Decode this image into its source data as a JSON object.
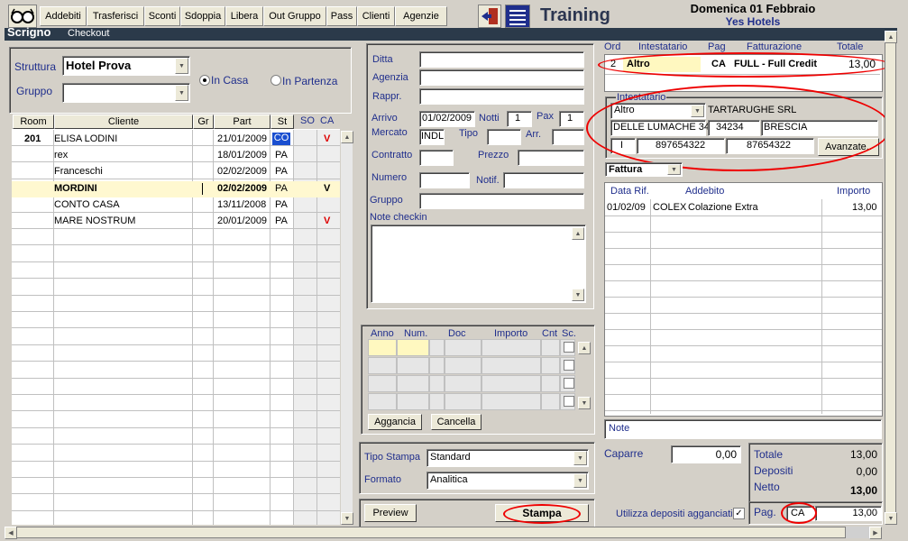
{
  "toolbar": {
    "buttons": [
      "Addebiti",
      "Trasferisci",
      "Sconti",
      "Sdoppia",
      "Libera",
      "Out Gruppo",
      "Pass",
      "Clienti",
      "Agenzie"
    ],
    "title": "Training",
    "date": "Domenica 01 Febbraio",
    "hotel": "Yes Hotels"
  },
  "titlebar": {
    "app": "Scrigno",
    "section": "Checkout"
  },
  "filter": {
    "struttura_label": "Struttura",
    "struttura_value": "Hotel Prova",
    "gruppo_label": "Gruppo",
    "gruppo_value": "",
    "radio_incasa": "In Casa",
    "radio_inpartenza": "In Partenza"
  },
  "guest_table": {
    "headers": [
      "Room",
      "Cliente",
      "Gr",
      "Part",
      "St",
      "SO",
      "CA"
    ],
    "rows": [
      {
        "room": "201",
        "cliente": "ELISA LODINI",
        "part": "21/01/2009",
        "st": "CO",
        "so": "",
        "ca": "V"
      },
      {
        "room": "",
        "cliente": "rex",
        "part": "18/01/2009",
        "st": "PA",
        "so": "",
        "ca": ""
      },
      {
        "room": "",
        "cliente": "Franceschi",
        "part": "02/02/2009",
        "st": "PA",
        "so": "",
        "ca": ""
      },
      {
        "room": "",
        "cliente": "MORDINI",
        "part": "02/02/2009",
        "st": "PA",
        "so": "",
        "ca": "V"
      },
      {
        "room": "",
        "cliente": "CONTO CASA",
        "part": "13/11/2008",
        "st": "PA",
        "so": "",
        "ca": ""
      },
      {
        "room": "",
        "cliente": "MARE NOSTRUM",
        "part": "20/01/2009",
        "st": "PA",
        "so": "",
        "ca": "V"
      }
    ]
  },
  "details": {
    "ditta": "Ditta",
    "agenzia": "Agenzia",
    "rappr": "Rappr.",
    "arrivo_label": "Arrivo",
    "arrivo_value": "01/02/2009",
    "notti_label": "Notti",
    "notti_value": "1",
    "pax_label": "Pax",
    "pax_value": "1",
    "mercato_label": "Mercato",
    "mercato_value": "INDL",
    "tipo_label": "Tipo",
    "arr_label": "Arr.",
    "contratto_label": "Contratto",
    "prezzo_label": "Prezzo",
    "numero_label": "Numero",
    "notif_label": "Notif.",
    "gruppo_label": "Gruppo",
    "note_label": "Note checkin"
  },
  "deposits": {
    "headers": [
      "Anno",
      "Num.",
      "Doc",
      "Importo",
      "Cnt",
      "Sc."
    ],
    "aggancia": "Aggancia",
    "cancella": "Cancella"
  },
  "print": {
    "tipo_label": "Tipo Stampa",
    "tipo_value": "Standard",
    "formato_label": "Formato",
    "formato_value": "Analitica",
    "preview": "Preview",
    "stampa": "Stampa"
  },
  "accounts": {
    "headers": [
      "Ord",
      "Intestatario",
      "Pag",
      "Fatturazione",
      "Totale"
    ],
    "row": {
      "ord": "2",
      "intestatario": "Altro",
      "pag": "CA",
      "fatturazione": "FULL - Full Credit",
      "totale": "13,00"
    }
  },
  "intestatario": {
    "label": "Intestatario",
    "tipo": "Altro",
    "nome": "TARTARUGHE SRL",
    "indirizzo": "DELLE LUMACHE 34",
    "cap": "34234",
    "citta": "BRESCIA",
    "naz": "I",
    "piva": "897654322",
    "cf": "87654322",
    "avanzate": "Avanzate.."
  },
  "fattura": {
    "doc_type": "Fattura",
    "headers": [
      "Data Rif.",
      "Addebito",
      "Importo"
    ],
    "rows": [
      {
        "data": "01/02/09",
        "cod": "COLEX",
        "desc": "Colazione Extra",
        "importo": "13,00"
      }
    ],
    "note_label": "Note"
  },
  "totals": {
    "caparre_label": "Caparre",
    "caparre_value": "0,00",
    "totale_label": "Totale",
    "totale_value": "13,00",
    "depositi_label": "Depositi",
    "depositi_value": "0,00",
    "netto_label": "Netto",
    "netto_value": "13,00",
    "utilizza_label": "Utilizza depositi agganciati",
    "pag_label": "Pag.",
    "pag_value": "CA",
    "pag_amount": "13,00"
  }
}
